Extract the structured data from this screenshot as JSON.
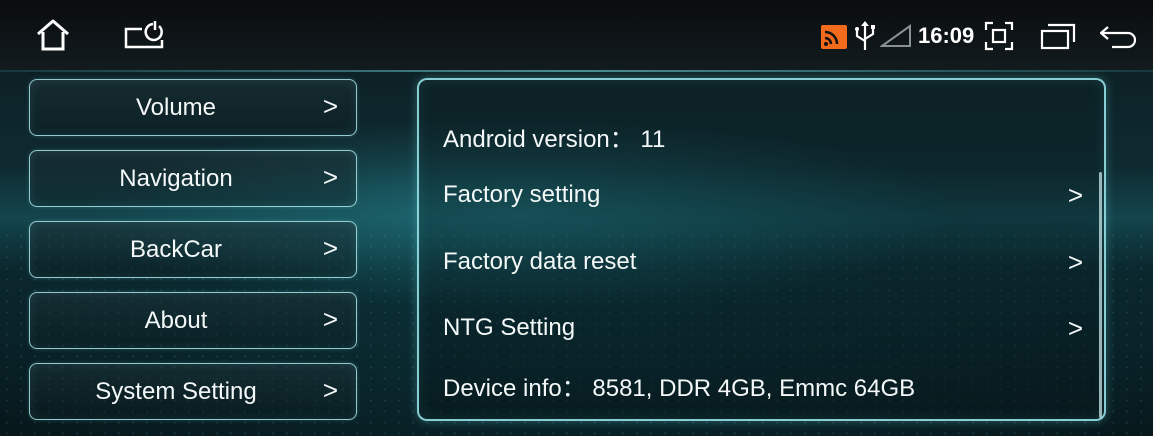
{
  "status_bar": {
    "icons": [
      "home-icon",
      "screen-power-icon",
      "cast-icon",
      "usb-icon",
      "signal-icon",
      "screenshot-icon",
      "recent-apps-icon",
      "back-icon"
    ],
    "time": "16:09",
    "cast_icon_color": "#f26a1b"
  },
  "menu": {
    "items": [
      {
        "label": "Volume"
      },
      {
        "label": "Navigation"
      },
      {
        "label": "BackCar"
      },
      {
        "label": "About"
      },
      {
        "label": "System Setting"
      }
    ],
    "chevron": ">"
  },
  "panel": {
    "android_version": "Android version： 11",
    "factory_setting": "Factory setting",
    "factory_data_reset": "Factory data reset",
    "ntg_setting": "NTG Setting",
    "device_info": "Device info： 8581, DDR 4GB, Emmc 64GB",
    "chevron": ">"
  },
  "colors": {
    "accent_border": "#96e1e8",
    "text": "#f4f8f8"
  }
}
